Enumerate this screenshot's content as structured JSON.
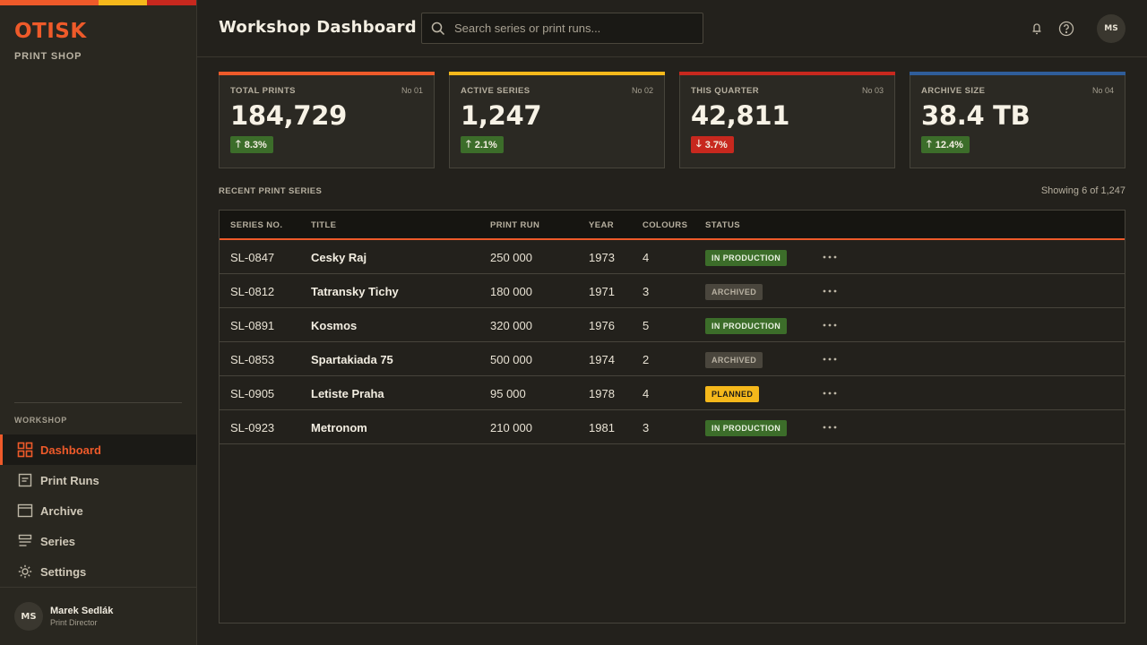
{
  "brand": {
    "name": "OTISK",
    "subtitle": "PRINT SHOP"
  },
  "colors": {
    "accent": "#ee5a2a",
    "yellow": "#f5b81b",
    "red": "#c7281e",
    "blue": "#2f5d9a",
    "green": "#3c6d2a"
  },
  "sidebar": {
    "section_label": "WORKSHOP",
    "items": [
      {
        "label": "Dashboard",
        "icon": "grid-icon",
        "active": true
      },
      {
        "label": "Print Runs",
        "icon": "document-icon",
        "active": false
      },
      {
        "label": "Archive",
        "icon": "archive-icon",
        "active": false
      },
      {
        "label": "Series",
        "icon": "list-icon",
        "active": false
      },
      {
        "label": "Settings",
        "icon": "gear-icon",
        "active": false
      }
    ],
    "user": {
      "initials": "MS",
      "name": "Marek Sedlák",
      "role": "Print Director"
    }
  },
  "header": {
    "title": "Workshop Dashboard",
    "search": {
      "placeholder": "Search series or print runs...",
      "value": ""
    },
    "icons": [
      "bell-icon",
      "help-icon"
    ],
    "avatar_initials": "MS"
  },
  "stats": [
    {
      "label": "TOTAL PRINTS",
      "no": "No 01",
      "value": "184,729",
      "delta": "8.3%",
      "direction": "up"
    },
    {
      "label": "ACTIVE SERIES",
      "no": "No 02",
      "value": "1,247",
      "delta": "2.1%",
      "direction": "up"
    },
    {
      "label": "THIS QUARTER",
      "no": "No 03",
      "value": "42,811",
      "delta": "3.7%",
      "direction": "down"
    },
    {
      "label": "ARCHIVE SIZE",
      "no": "No 04",
      "value": "38.4 TB",
      "delta": "12.4%",
      "direction": "up"
    }
  ],
  "recent": {
    "title": "RECENT PRINT SERIES",
    "count": "Showing 6 of 1,247",
    "columns": [
      "SERIES NO.",
      "TITLE",
      "PRINT RUN",
      "YEAR",
      "COLOURS",
      "STATUS"
    ],
    "rows": [
      {
        "series": "SL-0847",
        "title": "Cesky Raj",
        "run": "250 000",
        "year": "1973",
        "colours": "4",
        "status": "IN PRODUCTION"
      },
      {
        "series": "SL-0812",
        "title": "Tatransky Tichy",
        "run": "180 000",
        "year": "1971",
        "colours": "3",
        "status": "ARCHIVED"
      },
      {
        "series": "SL-0891",
        "title": "Kosmos",
        "run": "320 000",
        "year": "1976",
        "colours": "5",
        "status": "IN PRODUCTION"
      },
      {
        "series": "SL-0853",
        "title": "Spartakiada 75",
        "run": "500 000",
        "year": "1974",
        "colours": "2",
        "status": "ARCHIVED"
      },
      {
        "series": "SL-0905",
        "title": "Letiste Praha",
        "run": "95 000",
        "year": "1978",
        "colours": "4",
        "status": "PLANNED"
      },
      {
        "series": "SL-0923",
        "title": "Metronom",
        "run": "210 000",
        "year": "1981",
        "colours": "3",
        "status": "IN PRODUCTION"
      }
    ]
  }
}
